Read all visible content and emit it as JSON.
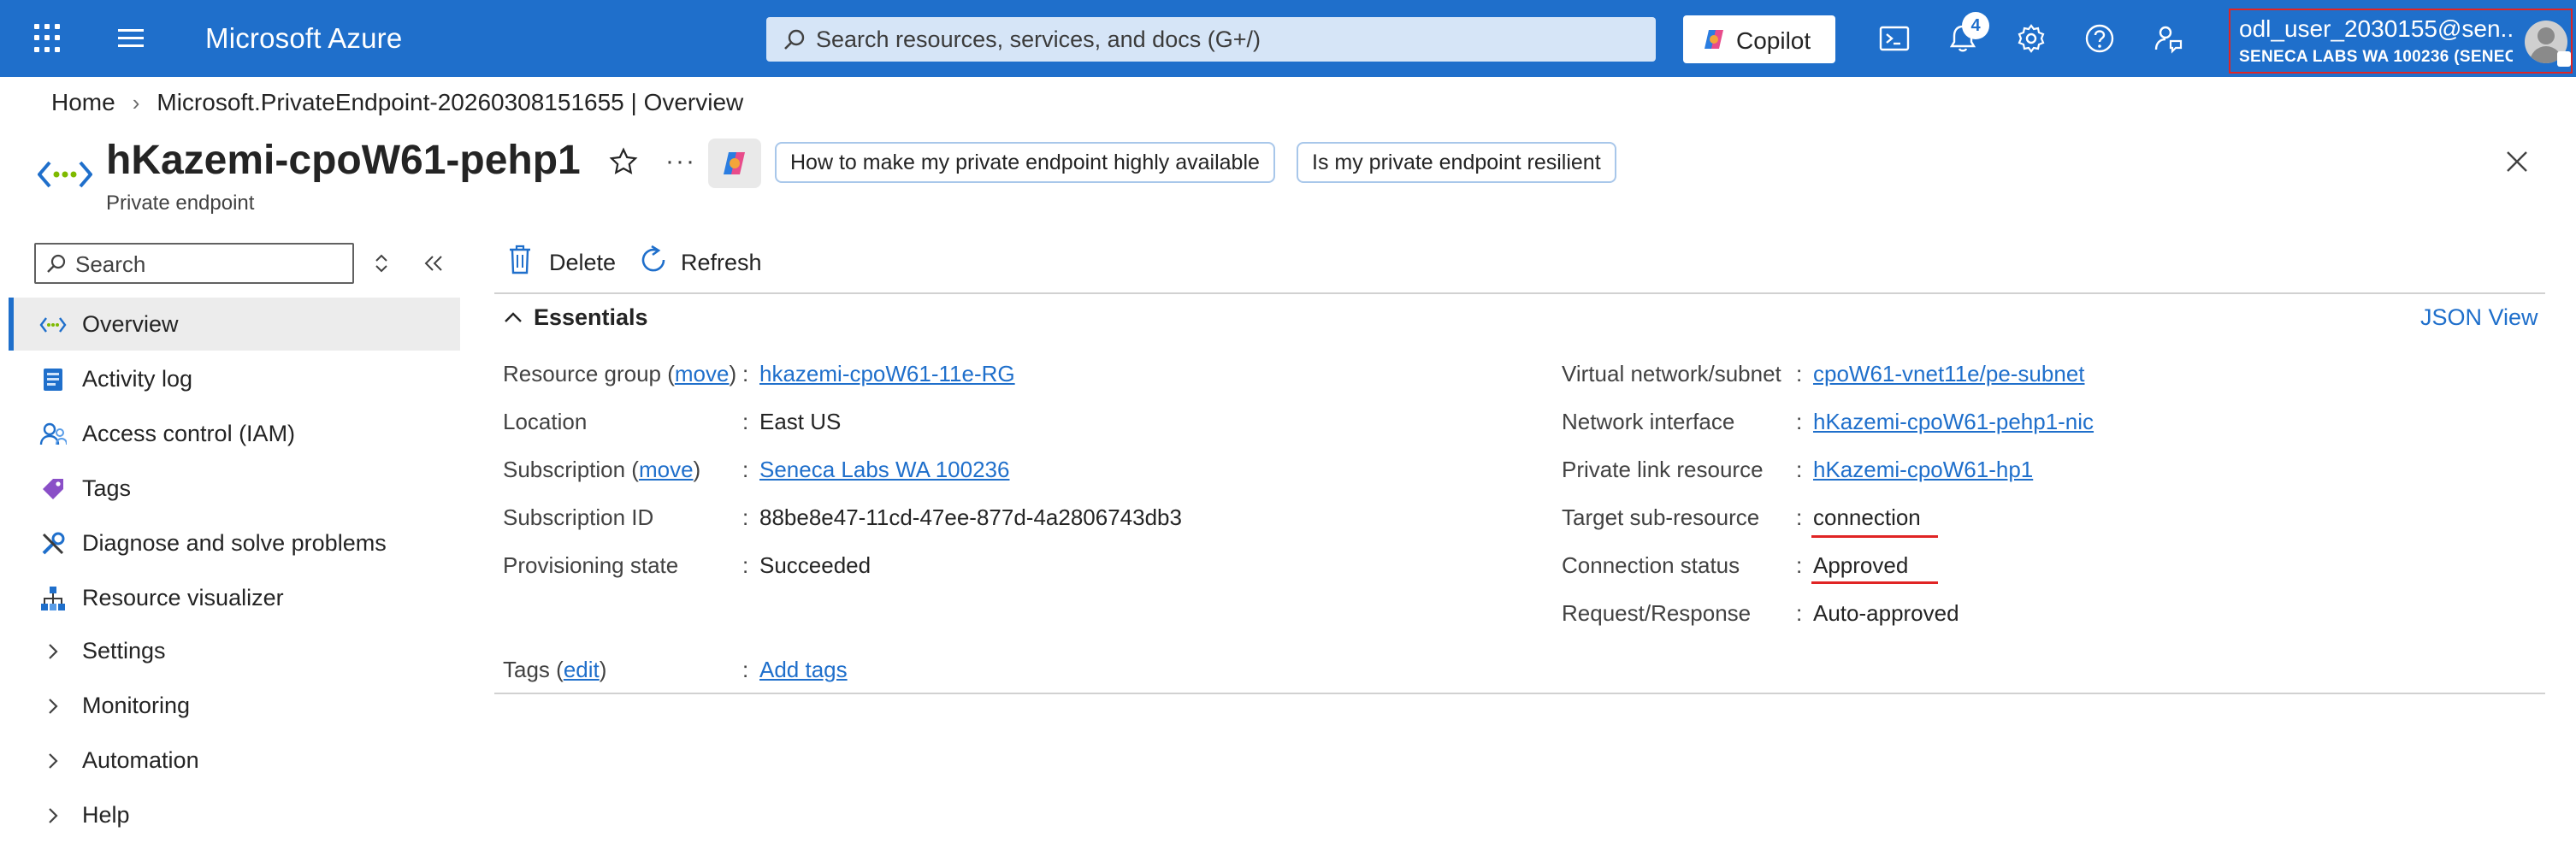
{
  "topbar": {
    "brand": "Microsoft Azure",
    "search_placeholder": "Search resources, services, and docs (G+/)",
    "copilot_label": "Copilot",
    "notifications_count": "4",
    "user_name": "odl_user_2030155@sen...",
    "user_tenant": "SENECA LABS WA 100236 (SENEC..."
  },
  "breadcrumb": {
    "home": "Home",
    "deployment": "Microsoft.PrivateEndpoint-20260308151655 | Overview"
  },
  "header": {
    "title": "hKazemi-cpoW61-pehp1",
    "subtitle": "Private endpoint",
    "prompt_1": "How to make my private endpoint highly available",
    "prompt_2": "Is my private endpoint resilient",
    "more": "···"
  },
  "nav": {
    "search_placeholder": "Search",
    "items": [
      {
        "label": "Overview"
      },
      {
        "label": "Activity log"
      },
      {
        "label": "Access control (IAM)"
      },
      {
        "label": "Tags"
      },
      {
        "label": "Diagnose and solve problems"
      },
      {
        "label": "Resource visualizer"
      },
      {
        "label": "Settings"
      },
      {
        "label": "Monitoring"
      },
      {
        "label": "Automation"
      },
      {
        "label": "Help"
      }
    ]
  },
  "toolbar": {
    "delete_label": "Delete",
    "refresh_label": "Refresh"
  },
  "essentials": {
    "title": "Essentials",
    "json_view": "JSON View",
    "move_link": "move",
    "edit_link": "edit",
    "left": {
      "resource_group_label": "Resource group",
      "resource_group_value": "hkazemi-cpoW61-11e-RG",
      "location_label": "Location",
      "location_value": "East US",
      "subscription_label": "Subscription",
      "subscription_value": "Seneca Labs WA 100236",
      "subscription_id_label": "Subscription ID",
      "subscription_id_value": "88be8e47-11cd-47ee-877d-4a2806743db3",
      "provisioning_label": "Provisioning state",
      "provisioning_value": "Succeeded"
    },
    "right": {
      "vnet_label": "Virtual network/subnet",
      "vnet_value": "cpoW61-vnet11e/pe-subnet",
      "nic_label": "Network interface",
      "nic_value": "hKazemi-cpoW61-pehp1-nic",
      "plr_label": "Private link resource",
      "plr_value": "hKazemi-cpoW61-hp1",
      "target_label": "Target sub-resource",
      "target_value": "connection",
      "conn_status_label": "Connection status",
      "conn_status_value": "Approved",
      "reqresp_label": "Request/Response",
      "reqresp_value": "Auto-approved"
    },
    "tags_label": "Tags",
    "tags_value": "Add tags"
  },
  "colors": {
    "topbar": "#1f6fcb",
    "link": "#1f6fcb",
    "highlight": "#e02424"
  }
}
